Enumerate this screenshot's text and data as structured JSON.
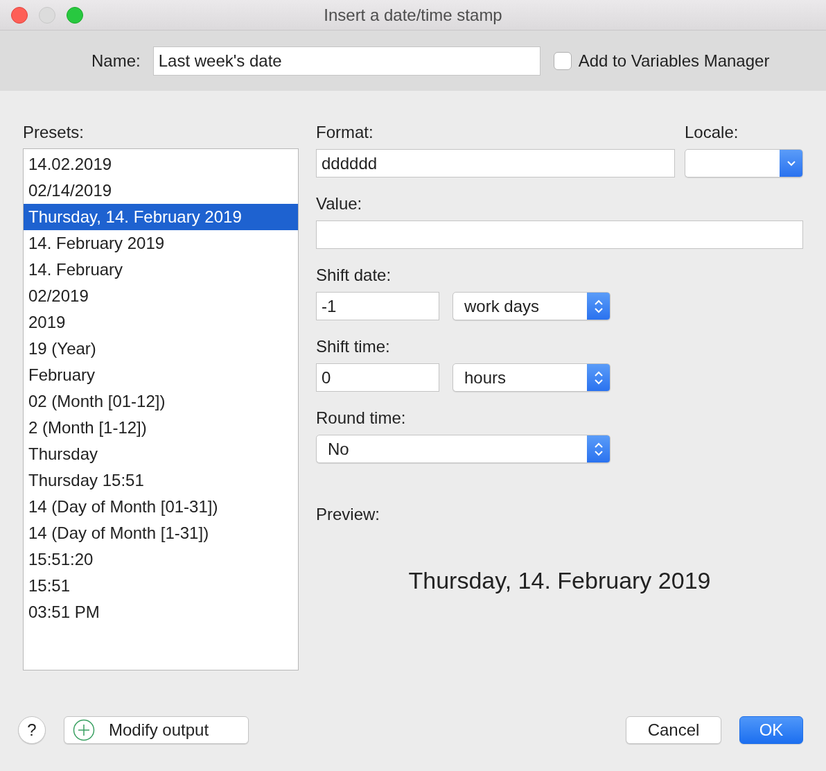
{
  "window": {
    "title": "Insert a date/time stamp"
  },
  "name_field": {
    "label": "Name:",
    "value": "Last week's date"
  },
  "add_to_variables": {
    "label": "Add to Variables Manager",
    "checked": false
  },
  "presets": {
    "label": "Presets:",
    "items": [
      {
        "label": "14.02.2019",
        "selected": false
      },
      {
        "label": "02/14/2019",
        "selected": false
      },
      {
        "label": "Thursday, 14. February 2019",
        "selected": true
      },
      {
        "label": "14. February 2019",
        "selected": false
      },
      {
        "label": "14. February",
        "selected": false
      },
      {
        "label": "02/2019",
        "selected": false
      },
      {
        "label": "2019",
        "selected": false
      },
      {
        "label": "19 (Year)",
        "selected": false
      },
      {
        "label": "February",
        "selected": false
      },
      {
        "label": "02 (Month [01-12])",
        "selected": false
      },
      {
        "label": "2 (Month [1-12])",
        "selected": false
      },
      {
        "label": "Thursday",
        "selected": false
      },
      {
        "label": "Thursday 15:51",
        "selected": false
      },
      {
        "label": "14 (Day of Month [01-31])",
        "selected": false
      },
      {
        "label": "14 (Day of Month [1-31])",
        "selected": false
      },
      {
        "label": "15:51:20",
        "selected": false
      },
      {
        "label": "15:51",
        "selected": false
      },
      {
        "label": "03:51 PM",
        "selected": false
      }
    ]
  },
  "format": {
    "label": "Format:",
    "value": "dddddd"
  },
  "locale": {
    "label": "Locale:"
  },
  "value": {
    "label": "Value:"
  },
  "shift_date": {
    "label": "Shift date:",
    "value": "-1",
    "unit": "work days"
  },
  "shift_time": {
    "label": "Shift time:",
    "value": "0",
    "unit": "hours"
  },
  "round_time": {
    "label": "Round time:",
    "value": "No"
  },
  "preview": {
    "label": "Preview:",
    "text": "Thursday, 14. February 2019"
  },
  "help_button": {
    "label": "?"
  },
  "modify_button": {
    "label": "Modify output"
  },
  "buttons": [
    {
      "label": "Cancel",
      "kind": "normal"
    },
    {
      "label": "OK",
      "kind": "default"
    }
  ]
}
